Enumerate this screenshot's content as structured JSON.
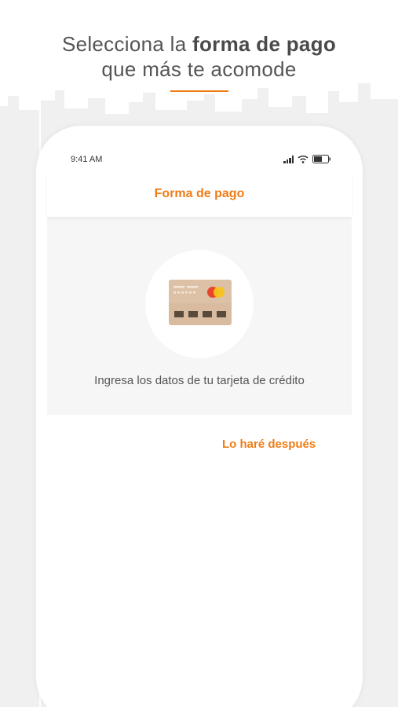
{
  "headline": {
    "line1_pre": "Selecciona la ",
    "line1_bold": "forma de pago",
    "line2": "que más te acomode"
  },
  "status_bar": {
    "time": "9:41 AM",
    "icons": [
      "signal-icon",
      "wifi-icon",
      "battery-icon"
    ]
  },
  "header": {
    "title": "Forma de pago"
  },
  "card_section": {
    "icon": "credit-card-icon",
    "prompt": "Ingresa los datos de tu tarjeta de crédito"
  },
  "actions": {
    "later_label": "Lo haré después"
  },
  "colors": {
    "accent": "#f07c16",
    "card_body": "#d9bca0",
    "card_chip_dark": "#5a4a3c",
    "panel_bg": "#f6f6f6",
    "skyline": "#efefef"
  }
}
